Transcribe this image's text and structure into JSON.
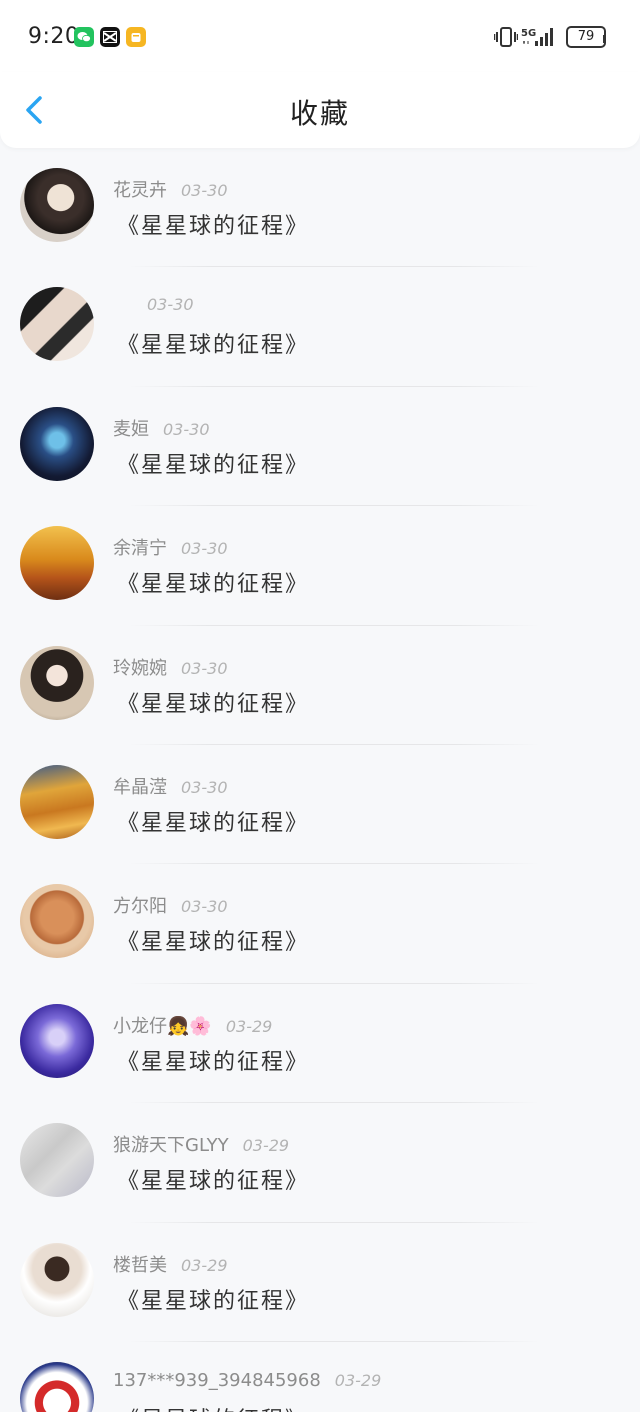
{
  "status_bar": {
    "time": "9:20",
    "network": "5G",
    "battery": "79",
    "apps": [
      "wechat-icon",
      "capcut-icon",
      "notes-icon"
    ]
  },
  "header": {
    "title": "收藏",
    "back_icon": "chevron-left-icon"
  },
  "colors": {
    "accent": "#2aa5f2",
    "background": "#f7f8fa"
  },
  "favorites": [
    {
      "user": "花灵卉",
      "date": "03-30",
      "title": "《星星球的征程》"
    },
    {
      "user": "",
      "date": "03-30",
      "title": "《星星球的征程》"
    },
    {
      "user": "麦姮",
      "date": "03-30",
      "title": "《星星球的征程》"
    },
    {
      "user": "余清宁",
      "date": "03-30",
      "title": "《星星球的征程》"
    },
    {
      "user": "玲婉婉",
      "date": "03-30",
      "title": "《星星球的征程》"
    },
    {
      "user": "牟晶滢",
      "date": "03-30",
      "title": "《星星球的征程》"
    },
    {
      "user": "方尔阳",
      "date": "03-30",
      "title": "《星星球的征程》"
    },
    {
      "user": "小龙仔👧🌸",
      "date": "03-29",
      "title": "《星星球的征程》"
    },
    {
      "user": "狼游天下GLYY",
      "date": "03-29",
      "title": "《星星球的征程》"
    },
    {
      "user": "楼哲美",
      "date": "03-29",
      "title": "《星星球的征程》"
    },
    {
      "user": "137***939_394845968",
      "date": "03-29",
      "title": "《星星球的征程》"
    }
  ]
}
